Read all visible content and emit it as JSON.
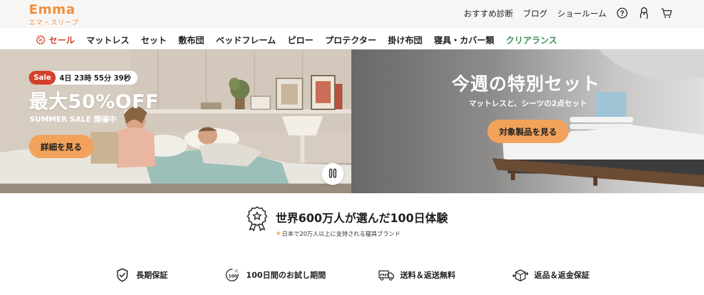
{
  "brand": {
    "logo_text": "Emma",
    "logo_subtitle": "エマ・スリープ",
    "accent_color": "#f08f3c"
  },
  "header": {
    "links": [
      "おすすめ診断",
      "ブログ",
      "ショールーム"
    ],
    "icons": [
      "help-icon",
      "account-icon",
      "cart-icon"
    ]
  },
  "nav": {
    "sale_label": "セール",
    "items": [
      "マットレス",
      "セット",
      "敷布団",
      "ベッドフレーム",
      "ピロー",
      "プロテクター",
      "掛け布団",
      "寝具・カバー類"
    ],
    "clearance_label": "クリアランス",
    "sale_color": "#d3402c",
    "clearance_color": "#3f8c5a"
  },
  "hero_left": {
    "sale_tag": "Sale",
    "countdown": "4日 23時 55分 39秒",
    "title": "最大50%OFF",
    "subtitle": "SUMMER SALE 開催中",
    "button_label": "詳細を見る"
  },
  "hero_right": {
    "title": "今週の特別セット",
    "subtitle": "マットレスと、シーツの2点セット",
    "button_label": "対象製品を見る"
  },
  "trust": {
    "title": "世界600万人が選んだ100日体験",
    "subtitle": "日本で20万人以上に支持される寝具ブランド"
  },
  "features": [
    {
      "label": "長期保証",
      "icon": "shield-check-icon"
    },
    {
      "label": "100日間のお試し期間",
      "icon": "trial-100-icon"
    },
    {
      "label": "送料＆返送無料",
      "icon": "free-shipping-truck-icon"
    },
    {
      "label": "返品＆返金保証",
      "icon": "return-box-icon"
    }
  ]
}
